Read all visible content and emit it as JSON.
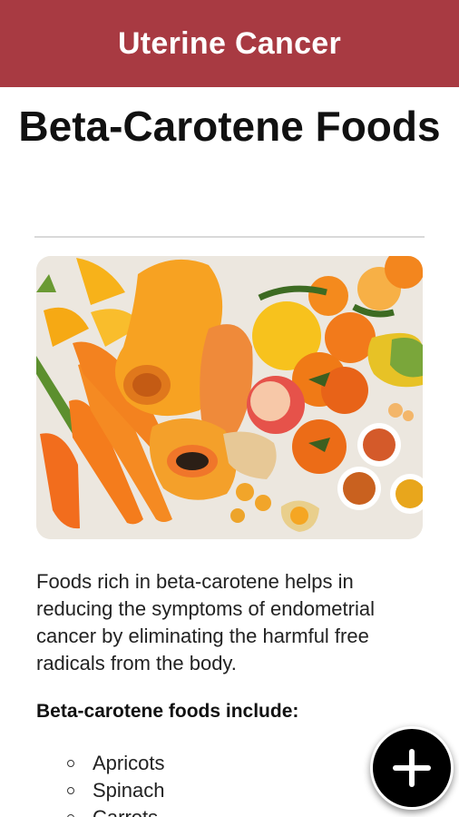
{
  "app_bar": {
    "title": "Uterine Cancer"
  },
  "article": {
    "title": "Beta-Carotene Foods",
    "intro": "Foods rich in beta-carotene helps in reducing the symptoms of endometrial cancer by eliminating the harmful free radicals from the body.",
    "list_heading": "Beta-carotene foods include:",
    "foods": [
      "Apricots",
      "Spinach",
      "Carrots"
    ]
  },
  "fab": {
    "icon": "plus-icon"
  },
  "colors": {
    "app_bar": "#a83a42",
    "fab": "#000000"
  }
}
